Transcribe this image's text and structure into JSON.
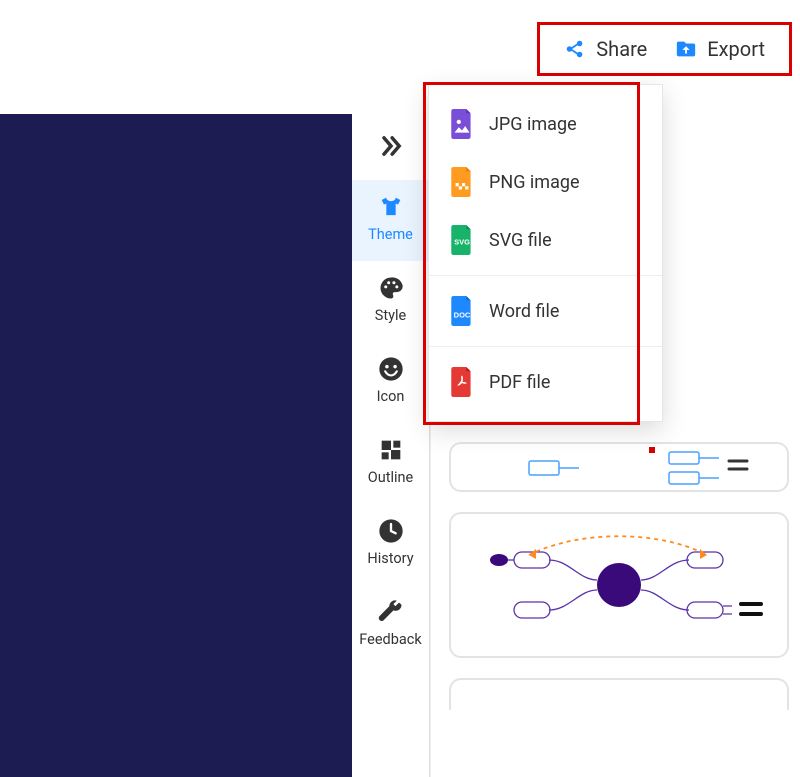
{
  "toolbar": {
    "share_label": "Share",
    "export_label": "Export"
  },
  "sidenav": {
    "items": [
      {
        "key": "theme",
        "label": "Theme"
      },
      {
        "key": "style",
        "label": "Style"
      },
      {
        "key": "icon",
        "label": "Icon"
      },
      {
        "key": "outline",
        "label": "Outline"
      },
      {
        "key": "history",
        "label": "History"
      },
      {
        "key": "feedback",
        "label": "Feedback"
      }
    ]
  },
  "export_menu": {
    "items": [
      {
        "key": "jpg",
        "label": "JPG image"
      },
      {
        "key": "png",
        "label": "PNG image"
      },
      {
        "key": "svg",
        "label": "SVG file"
      },
      {
        "key": "word",
        "label": "Word file"
      },
      {
        "key": "pdf",
        "label": "PDF file"
      }
    ]
  },
  "colors": {
    "accent": "#1e88ff",
    "highlight": "#d80000",
    "canvas": "#1d1c52",
    "purple_theme": "#4a148c"
  }
}
